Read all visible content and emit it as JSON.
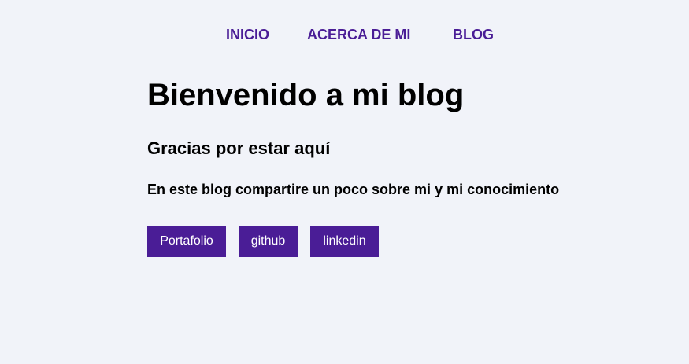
{
  "nav": {
    "items": [
      {
        "label": "INICIO"
      },
      {
        "label": "ACERCA DE MI"
      },
      {
        "label": "BLOG"
      }
    ]
  },
  "hero": {
    "title": "Bienvenido a mi blog",
    "subtitle": "Gracias por estar aquí",
    "lead": "En este blog compartire un poco sobre mi y mi conocimiento"
  },
  "buttons": [
    {
      "label": "Portafolio"
    },
    {
      "label": "github"
    },
    {
      "label": "linkedin"
    }
  ],
  "colors": {
    "background": "#f1f3f9",
    "accent": "#4a1d96",
    "text": "#000000",
    "button_text": "#ffffff"
  }
}
